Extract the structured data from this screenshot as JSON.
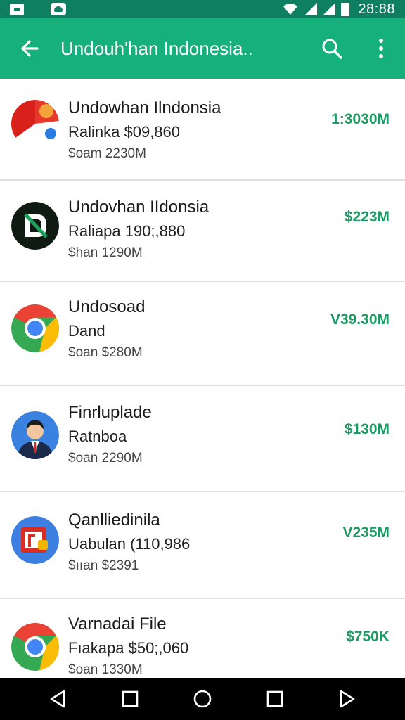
{
  "status_bar": {
    "time": "2⁠8:88",
    "icons": [
      "notification-box-icon",
      "android-icon",
      "wifi-icon",
      "signal-icon",
      "signal-icon",
      "battery-icon"
    ]
  },
  "app_bar": {
    "title": "Undouh'han Indonesia..",
    "back_icon": "arrow-left-icon",
    "search_icon": "search-icon",
    "more_icon": "more-vert-icon"
  },
  "colors": {
    "status_bar": "#0f7f62",
    "app_bar": "#16b07d",
    "price": "#1c9a63",
    "nav_bar": "#000000"
  },
  "items": [
    {
      "name": "Undowhan Ilndonsia",
      "subtitle": "Ralinka $09,860",
      "size": "$oam 2230M",
      "price": "1:3030M",
      "icon": "red-chat-app-icon"
    },
    {
      "name": "Undovhan IIdonsia",
      "subtitle": "Raliapa 190;,880",
      "size": "$han 1290M",
      "price": "$223M",
      "icon": "black-d-app-icon"
    },
    {
      "name": "Undosoad",
      "subtitle": "Dand",
      "size": "$oan $280M",
      "price": "V39.30M",
      "icon": "chrome-icon"
    },
    {
      "name": "Finrluplade",
      "subtitle": "Ratnboa",
      "size": "$oan 2290M",
      "price": "$130M",
      "icon": "businessman-avatar-icon"
    },
    {
      "name": "Qanlliedinila",
      "subtitle": "Uabulan (110,986",
      "size": "$ııan $2391",
      "price": "V235M",
      "icon": "slides-app-icon"
    },
    {
      "name": "Varnadai File",
      "subtitle": "Fıakapa $50;,060",
      "size": "$oan 1330M",
      "price": "$750K",
      "icon": "chrome-icon"
    }
  ],
  "nav_bar": {
    "icons": [
      "back-triangle-icon",
      "square-icon",
      "home-circle-icon",
      "recents-square-icon",
      "forward-triangle-icon"
    ]
  }
}
